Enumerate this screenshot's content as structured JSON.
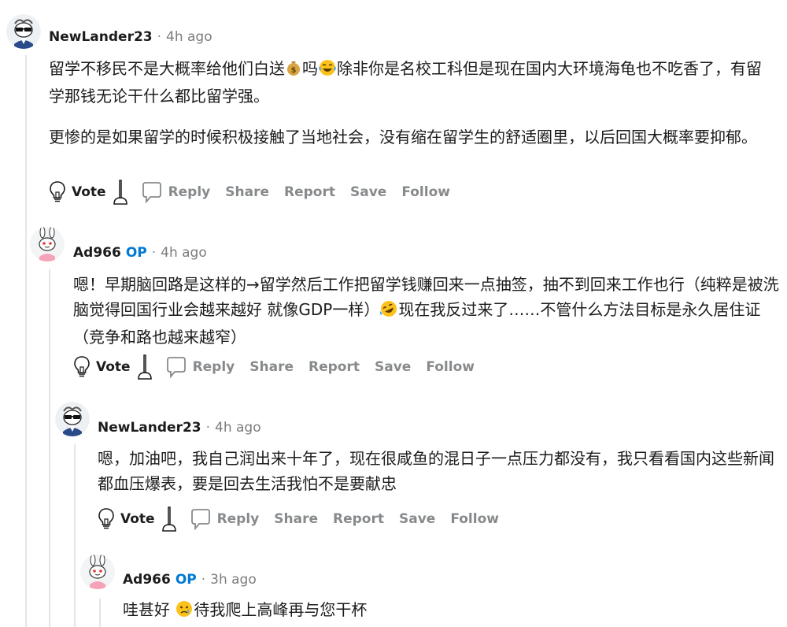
{
  "comments": [
    {
      "author": "NewLander23",
      "op": "",
      "time": "4h ago",
      "paragraphs": [
        {
          "parts": [
            "留学不移民不是大概率给他们白送",
            "吗",
            "除非你是名校工科但是现在国内大环境海龟也不吃香了，有留学那钱无论干什么都比留学强。"
          ],
          "emojis": [
            "money-bag",
            "tears-of-joy"
          ]
        },
        {
          "text": "更惨的是如果留学的时候积极接触了当地社会，没有缩在留学生的舒适圈里，以后回国大概率要抑郁。"
        }
      ]
    },
    {
      "author": "Ad966",
      "op": "OP",
      "time": "4h ago",
      "paragraphs": [
        {
          "parts": [
            "嗯！早期脑回路是这样的→留学然后工作把留学钱赚回来一点抽签，抽不到回来工作也行（纯粹是被洗脑觉得回国行业会越来越好 就像GDP一样）",
            "现在我反过来了……不管什么方法目标是永久居住证（竞争和路也越来越窄）"
          ],
          "emojis": [
            "rofl"
          ]
        }
      ]
    },
    {
      "author": "NewLander23",
      "op": "",
      "time": "4h ago",
      "paragraphs": [
        {
          "text": "嗯，加油吧，我自己润出来十年了，现在很咸鱼的混日子一点压力都没有，我只看看国内这些新闻都血压爆表，要是回去生活我怕不是要献忠"
        }
      ]
    },
    {
      "author": "Ad966",
      "op": "OP",
      "time": "3h ago",
      "paragraphs": [
        {
          "parts": [
            "哇甚好 ",
            "待我爬上高峰再与您干杯"
          ],
          "emojis": [
            "crying-face"
          ]
        }
      ]
    }
  ],
  "actions": {
    "vote": "Vote",
    "reply": "Reply",
    "share": "Share",
    "report": "Report",
    "save": "Save",
    "follow": "Follow"
  },
  "icons": {
    "upvote": "lightbulb-icon",
    "downvote": "plunger-icon",
    "reply": "speech-bubble-icon"
  },
  "colors": {
    "op_badge": "#0079d3",
    "muted_text": "#878a8c",
    "thread_line": "#e3e5e8"
  }
}
